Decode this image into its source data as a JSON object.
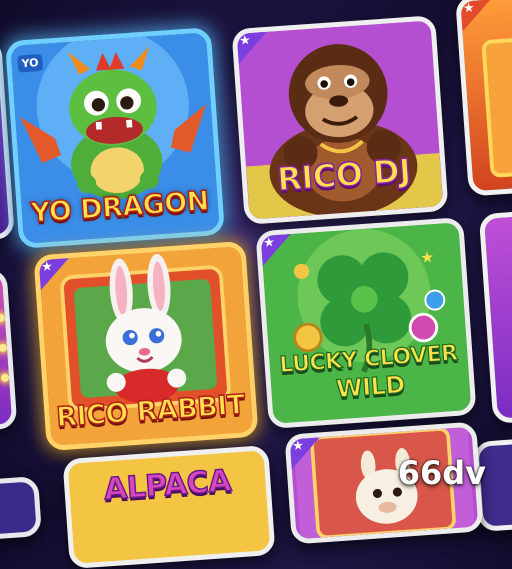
{
  "tiles": {
    "yo_dragon": {
      "title": "YO DRAGON",
      "badge": "YO"
    },
    "rico_dj": {
      "title": "RICO DJ"
    },
    "rico_rabbit": {
      "title": "RICO RABBIT"
    },
    "lucky_clover": {
      "title_line1": "LUCKY CLOVER",
      "title_line2": "WILD"
    },
    "alpaca": {
      "title": "ALPACA"
    }
  },
  "watermark": "66dv",
  "colors": {
    "background": "#1c1440",
    "dragon_frame": "#2f7fe0",
    "dj_frame": "#b03fc9",
    "rabbit_frame": "#f08a1c",
    "clover_frame": "#3fa63a",
    "title_fill": "#ffe14a",
    "title_stroke": "#b0201a",
    "clover_title": "#ffe14a"
  },
  "icons": [
    "dragon-character",
    "gorilla-character",
    "rabbit-character",
    "four-leaf-clover",
    "alpaca-character",
    "star-icon",
    "marquee-bulb"
  ]
}
